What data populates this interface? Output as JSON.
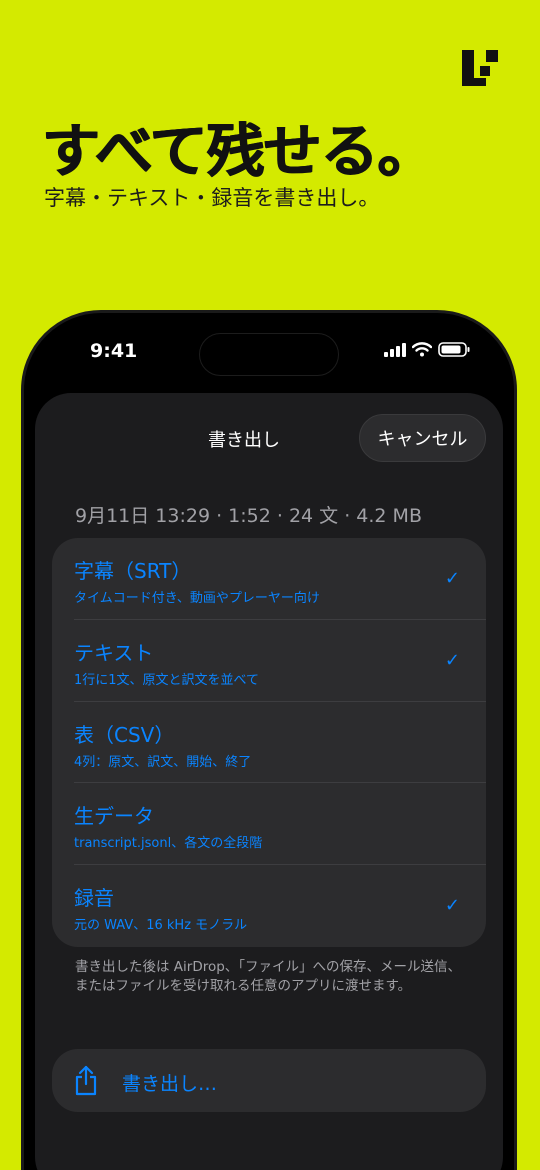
{
  "brand": {
    "logo_icon": "pixel-logo-icon"
  },
  "hero": {
    "title": "すべて残せる。",
    "subtitle": "字幕・テキスト・録音を書き出し。"
  },
  "status_bar": {
    "time": "9:41",
    "icons": [
      "signal-icon",
      "wifi-icon",
      "battery-icon"
    ]
  },
  "sheet": {
    "title": "書き出し",
    "cancel_label": "キャンセル",
    "meta": "9月11日 13:29 · 1:52 · 24 文 · 4.2 MB",
    "options": [
      {
        "title": "字幕（SRT）",
        "subtitle": "タイムコード付き、動画やプレーヤー向け",
        "checked": true
      },
      {
        "title": "テキスト",
        "subtitle": "1行に1文、原文と訳文を並べて",
        "checked": true
      },
      {
        "title": "表（CSV）",
        "subtitle": "4列：原文、訳文、開始、終了",
        "checked": false
      },
      {
        "title": "生データ",
        "subtitle": "transcript.jsonl、各文の全段階",
        "checked": false
      },
      {
        "title": "録音",
        "subtitle": "元の WAV、16 kHz モノラル",
        "checked": true
      }
    ],
    "note": "書き出した後は AirDrop、「ファイル」への保存、メール送信、またはファイルを受け取れる任意のアプリに渡せます。",
    "export_label": "書き出し…",
    "check_glyph": "✓"
  },
  "colors": {
    "background": "#d4ea00",
    "accent": "#0a84ff",
    "sheet": "#1c1c1e",
    "card": "#2c2c2e"
  }
}
